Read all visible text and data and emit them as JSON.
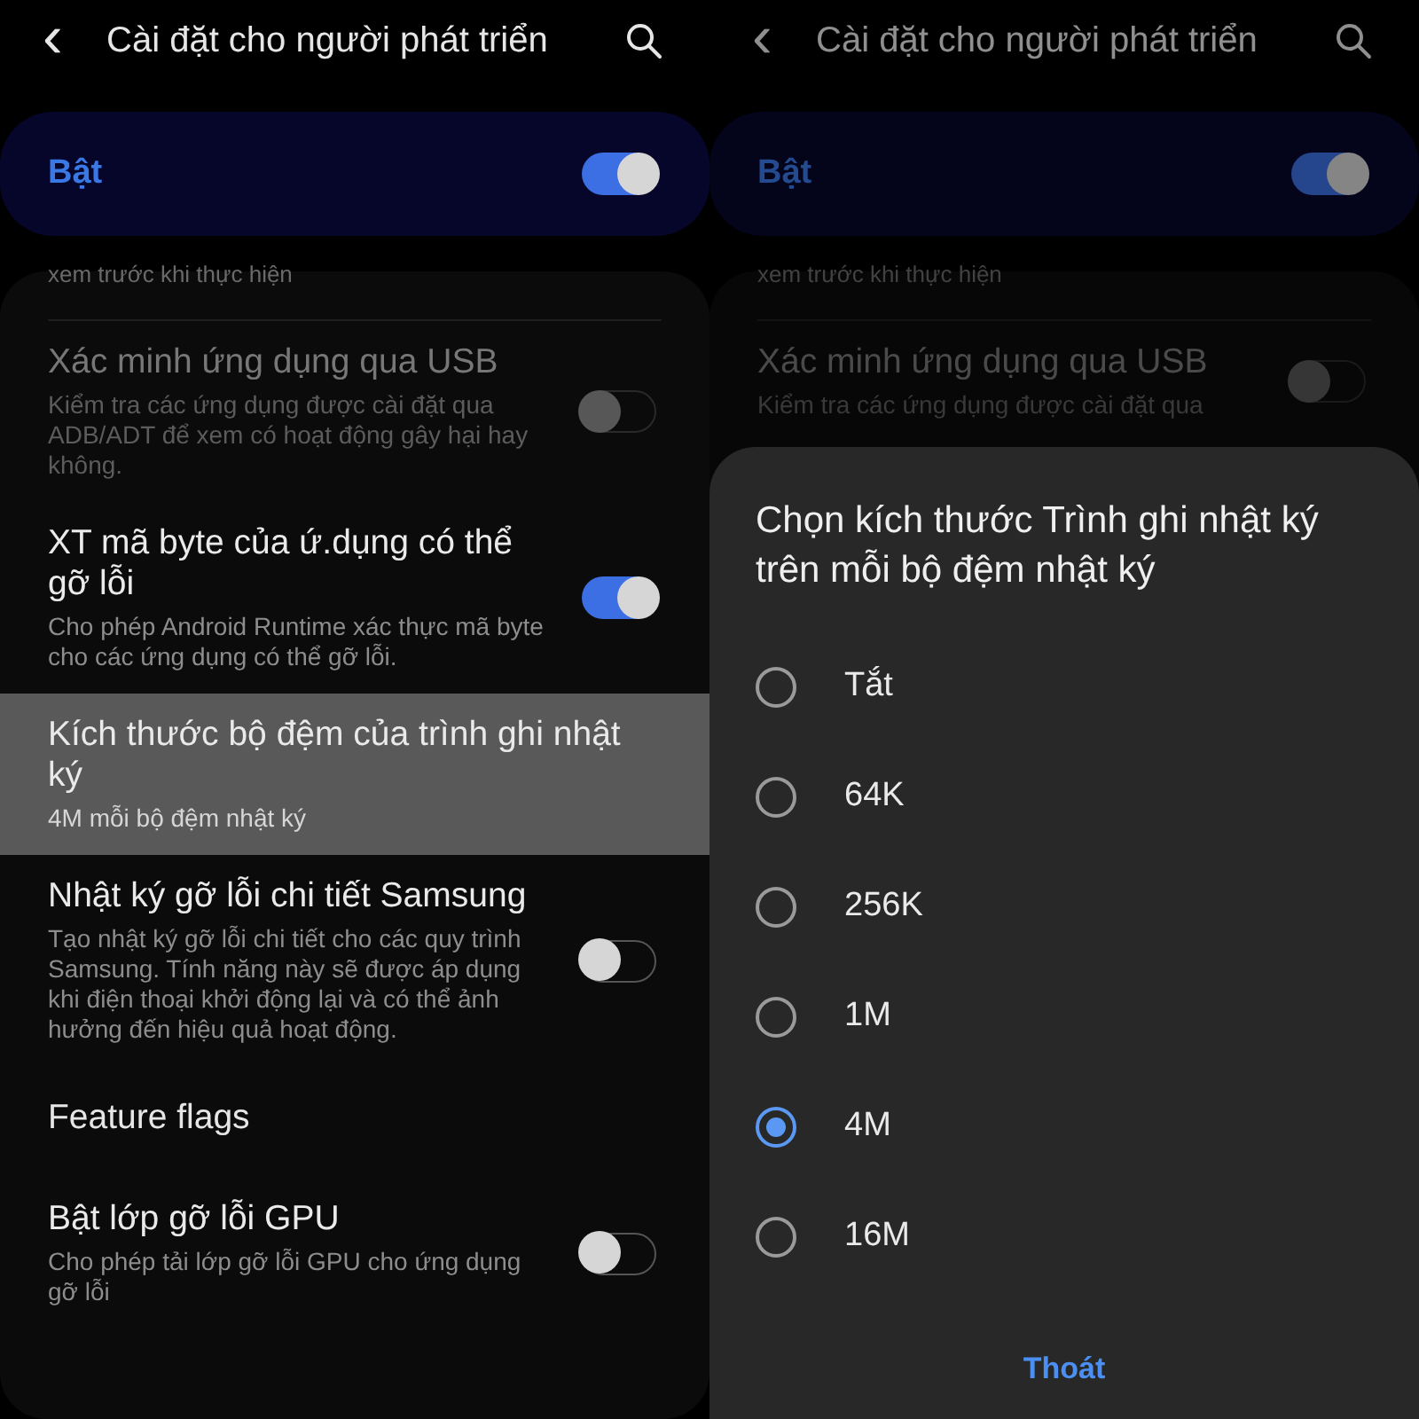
{
  "panels": [
    {
      "dimmed": false,
      "header": {
        "back": "‹",
        "title": "Cài đặt cho người phát triển"
      },
      "master": {
        "label": "Bật",
        "on": true
      },
      "items": [
        {
          "kind": "partial",
          "text": "xem trước khi thực hiện"
        },
        {
          "kind": "switch",
          "title": "Xác minh ứng dụng qua USB",
          "summary": "Kiểm tra các ứng dụng được cài đặt qua ADB/ADT để xem có hoạt động gây hại hay không.",
          "on": false,
          "disabled": true
        },
        {
          "kind": "switch",
          "title": "XT mã byte của ứ.dụng có thể gỡ lỗi",
          "summary": "Cho phép Android Runtime xác thực mã byte cho các ứng dụng có thể gỡ lỗi.",
          "on": true,
          "disabled": false
        },
        {
          "kind": "value",
          "title": "Kích thước bộ đệm của trình ghi nhật ký",
          "summary": "4M mỗi bộ đệm nhật ký",
          "selected": true
        },
        {
          "kind": "switch",
          "title": "Nhật ký gỡ lỗi chi tiết Samsung",
          "summary": "Tạo nhật ký gỡ lỗi chi tiết cho các quy trình Samsung. Tính năng này sẽ được áp dụng khi điện thoại khởi động lại và có thể ảnh hưởng đến hiệu quả hoạt động.",
          "on": false,
          "disabled": false
        },
        {
          "kind": "category",
          "title": "Feature flags"
        },
        {
          "kind": "switch",
          "title": "Bật lớp gỡ lỗi GPU",
          "summary": "Cho phép tải lớp gỡ lỗi GPU cho ứng dụng gỡ lỗi",
          "on": false,
          "disabled": false
        }
      ]
    },
    {
      "dimmed": true,
      "header": {
        "back": "‹",
        "title": "Cài đặt cho người phát triển"
      },
      "master": {
        "label": "Bật",
        "on": true
      },
      "items": [
        {
          "kind": "partial",
          "text": "xem trước khi thực hiện"
        },
        {
          "kind": "switch",
          "title": "Xác minh ứng dụng qua USB",
          "summary": "Kiểm tra các ứng dụng được cài đặt qua",
          "on": false,
          "disabled": true
        }
      ],
      "dialog": {
        "title": "Chọn kích thước Trình ghi nhật ký trên mỗi bộ đệm nhật ký",
        "options": [
          {
            "label": "Tắt",
            "selected": false
          },
          {
            "label": "64K",
            "selected": false
          },
          {
            "label": "256K",
            "selected": false
          },
          {
            "label": "1M",
            "selected": false
          },
          {
            "label": "4M",
            "selected": true
          },
          {
            "label": "16M",
            "selected": false
          }
        ],
        "button": "Thoát"
      }
    }
  ]
}
